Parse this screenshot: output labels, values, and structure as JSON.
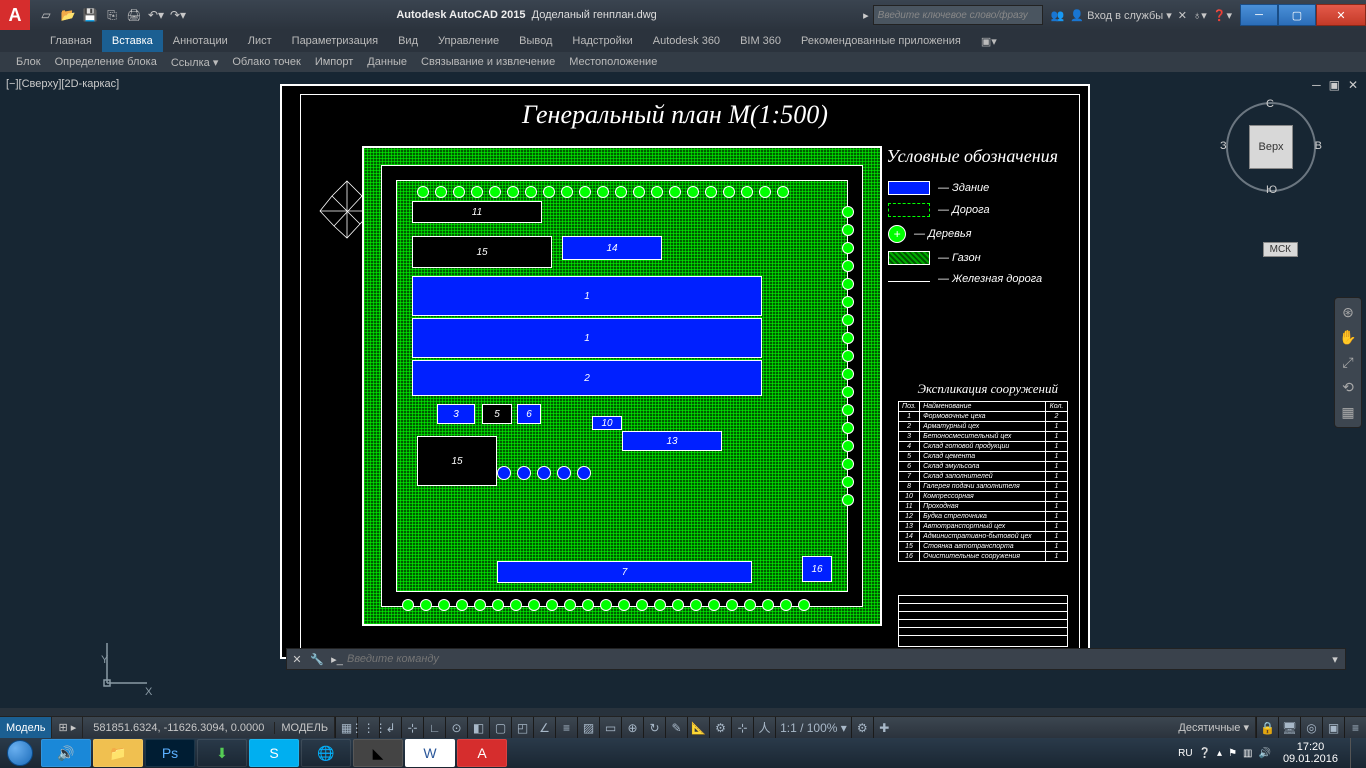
{
  "app": {
    "name": "Autodesk AutoCAD 2015",
    "file": "Доделаный генплан.dwg",
    "search_placeholder": "Введите ключевое слово/фразу",
    "login": "Вход в службы"
  },
  "ribbon": {
    "tabs": [
      "Главная",
      "Вставка",
      "Аннотации",
      "Лист",
      "Параметризация",
      "Вид",
      "Управление",
      "Вывод",
      "Надстройки",
      "Autodesk 360",
      "BIM 360",
      "Рекомендованные приложения"
    ],
    "active": 1,
    "sub": [
      "Блок",
      "Определение блока",
      "Ссылка ▾",
      "Облако точек",
      "Импорт",
      "Данные",
      "Связывание и извлечение",
      "Местоположение"
    ]
  },
  "view": {
    "label": "[−][Сверху][2D-каркас]",
    "cube": "Верх",
    "dirs": {
      "n": "С",
      "s": "Ю",
      "e": "В",
      "w": "З"
    },
    "ucs": "МСК"
  },
  "drawing": {
    "title": "Генеральный план  М(1:500)",
    "legend_title": "Условные обозначения",
    "legend": [
      {
        "key": "blue",
        "label": "— Здание"
      },
      {
        "key": "road",
        "label": "— Дорога"
      },
      {
        "key": "tree",
        "label": "— Деревья"
      },
      {
        "key": "lawn",
        "label": "— Газон"
      },
      {
        "key": "rail",
        "label": "— Железная дорога"
      }
    ],
    "expl_title": "Экспликация сооружений",
    "expl_head": {
      "pos": "Поз.",
      "name": "Найменование",
      "qty": "Кол."
    },
    "expl": [
      {
        "n": "1",
        "name": "Формовочные цеха",
        "q": "2"
      },
      {
        "n": "2",
        "name": "Арматурный цех",
        "q": "1"
      },
      {
        "n": "3",
        "name": "Бетоносмесительный цех",
        "q": "1"
      },
      {
        "n": "4",
        "name": "Склад готовой продукции",
        "q": "1"
      },
      {
        "n": "5",
        "name": "Склад цемента",
        "q": "1"
      },
      {
        "n": "6",
        "name": "Склад эмульсола",
        "q": "1"
      },
      {
        "n": "7",
        "name": "Склад заполнителей",
        "q": "1"
      },
      {
        "n": "8",
        "name": "Галерея подачи заполнителя",
        "q": "1"
      },
      {
        "n": "10",
        "name": "Компрессорная",
        "q": "1"
      },
      {
        "n": "11",
        "name": "Проходная",
        "q": "1"
      },
      {
        "n": "12",
        "name": "Будка стрелочника",
        "q": "1"
      },
      {
        "n": "13",
        "name": "Автотранспортный цех",
        "q": "1"
      },
      {
        "n": "14",
        "name": "Административно-бытовой цех",
        "q": "1"
      },
      {
        "n": "15",
        "name": "Стоянка автотранспорта",
        "q": "1"
      },
      {
        "n": "16",
        "name": "Очистительные сооружения",
        "q": "1"
      }
    ],
    "windrose": "Роза ветров",
    "buildings": [
      "1",
      "1",
      "2",
      "3",
      "5",
      "6",
      "7",
      "10",
      "11",
      "13",
      "14",
      "15",
      "15",
      "16"
    ]
  },
  "cmd": {
    "placeholder": "Введите команду"
  },
  "status": {
    "model": "Модель",
    "coords": "581851.6324, -11626.3094, 0.0000",
    "model2": "МОДЕЛЬ",
    "scale": "1:1 / 100% ▾",
    "units": "Десятичные ▾"
  },
  "taskbar": {
    "lang": "RU",
    "time": "17:20",
    "date": "09.01.2016"
  }
}
